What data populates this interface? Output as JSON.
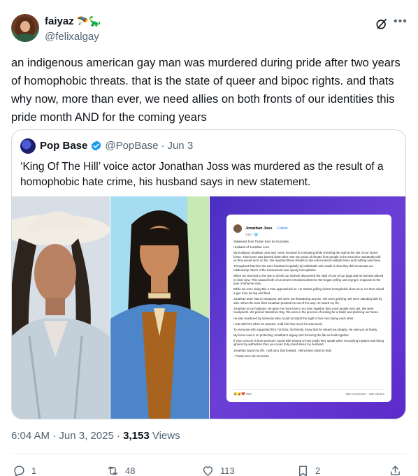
{
  "author": {
    "display_name": "faiyaz",
    "emojis": "🪂🦕",
    "handle": "@felixalgay"
  },
  "tweet_text": "an indigenous american gay man was murdered during pride after two years of homophobic threats. that is the state of queer and bipoc rights. and thats why now, more than ever, we need allies on both fronts of our identities this pride month AND for the coming years",
  "quote": {
    "name": "Pop Base",
    "handle": "@PopBase",
    "dot": "·",
    "date": "Jun 3",
    "text": "‘King Of The Hill’ voice actor Jonathan Joss was murdered as the result of a homophobic hate crime, his husband says in new statement.",
    "doc": {
      "name": "Jonathan Joss",
      "follow": "· Follow",
      "meta": "23m · 🌐",
      "lines": [
        "Statement from Tristan Kern de Gonzales",
        "Husband of Jonathan Joss",
        "My husband Jonathan Joss and I were involved in a shooting while checking the mail at the site of our former home. That home was burned down after over two years of threats from people in the area who repeatedly told us they would set it on fire. We reported these threats to law enforcement multiple times and nothing was done.",
        "Throughout that time we were harassed regularly by individuals who made it clear they did not accept our relationship. Much of the harassment was openly homophobic.",
        "When we returned to the site to check our mail we discovered the skull of one of our dogs and its harness placed in clear view. This caused both of us severe emotional distress. We began yelling and crying in response to the pain of what we saw.",
        "While we were doing this a man approached us. He started yelling violent homophobic slurs at us. He then raised a gun from his lap and fired.",
        "Jonathan and I had no weapons. We were not threatening anyone. We were grieving. We were standing side by side. When the man fired Jonathan pushed me out of the way. He saved my life.",
        "Jonathan is my husband. He gave me more love in our time together than most people ever get. We were newlyweds. We picked Valentines Day. We were in the process of looking for a trailer and planning our future.",
        "He was murdered by someone who could not stand the sight of two men loving each other.",
        "I was with him when he passed. I told him how much he was loved.",
        "To everyone who supported him, his fans, his friends, know that he valued you deeply. He saw you as family.",
        "My focus now is on protecting Jonathan's legacy and honoring the life we built together.",
        "If your concern is how someone coped with trauma or how loudly they speak when recounting injustice and being ignored by authorities then you never truly cared about my husband.",
        "Jonathan saved my life. I will carry that forward. I will protect what he built.",
        "- Tristan Kern de Gonzales"
      ],
      "reactions": "😢😮❤️ 300",
      "comments": "183 comments · 322 shares"
    }
  },
  "meta": {
    "time": "6:04 AM",
    "sep1": "·",
    "date": "Jun 3, 2025",
    "sep2": "·",
    "views_count": "3,153",
    "views_label": "Views"
  },
  "actions": {
    "replies": "1",
    "reposts": "48",
    "likes": "113",
    "bookmarks": "2"
  },
  "colors": {
    "text": "#0f1419",
    "secondary": "#536471",
    "border": "#cfd9de",
    "verified": "#1d9bf0"
  }
}
